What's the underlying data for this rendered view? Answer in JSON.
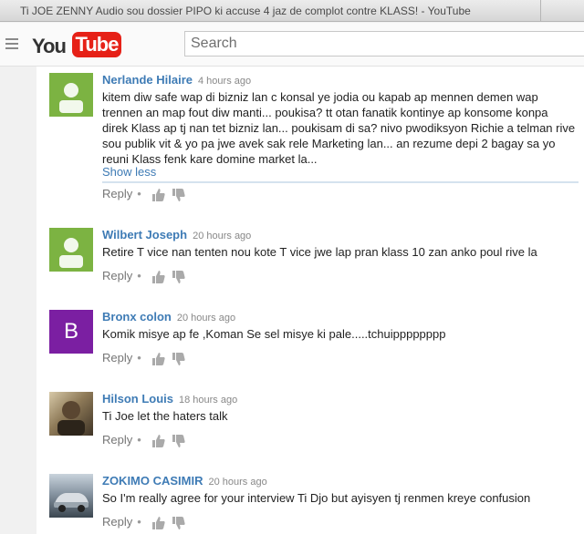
{
  "window": {
    "title": "Ti JOE ZENNY Audio sou dossier PIPO ki accuse 4 jaz de complot contre KLASS! - YouTube"
  },
  "header": {
    "logo_you": "You",
    "logo_tube": "Tube",
    "search_placeholder": "Search"
  },
  "comments": [
    {
      "author": "Nerlande Hilaire",
      "time": "4 hours ago",
      "text": "kitem diw safe wap di bizniz lan c konsal ye jodia ou kapab ap mennen demen wap trennen an map fout diw manti... poukisa? tt otan fanatik kontinye ap konsome konpa direk Klass ap tj nan tet bizniz lan... poukisam di sa? nivo pwodiksyon Richie a telman rive sou publik vit & yo pa jwe avek sak rele Marketing lan... an rezume depi 2 bagay sa yo reuni Klass fenk kare domine market la...",
      "show_less": "Show less",
      "reply": "Reply",
      "avatar": "default-avatar"
    },
    {
      "author": "Wilbert Joseph",
      "time": "20 hours ago",
      "text": "Retire T vice nan tenten nou kote T vice jwe lap pran klass 10 zan anko poul rive la",
      "reply": "Reply",
      "avatar": "default-avatar"
    },
    {
      "author": "Bronx colon",
      "time": "20 hours ago",
      "text": "Komik misye ap fe ,Koman Se sel misye  ki pale.....tchuipppppppp",
      "reply": "Reply",
      "avatar_letter": "B"
    },
    {
      "author": "Hilson Louis",
      "time": "18 hours ago",
      "text": "Ti Joe let the haters talk",
      "reply": "Reply",
      "avatar": "photo-avatar"
    },
    {
      "author": "ZOKIMO CASIMIR",
      "time": "20 hours ago",
      "text": "So I'm really agree for your interview Ti Djo but  ayisyen tj  renmen kreye  confusion",
      "reply": "Reply",
      "avatar": "car-photo-avatar"
    }
  ],
  "colors": {
    "author_link": "#3e7bb5",
    "logo_red": "#e62117",
    "avatar_green": "#7cb342",
    "avatar_purple": "#7b1fa2"
  }
}
